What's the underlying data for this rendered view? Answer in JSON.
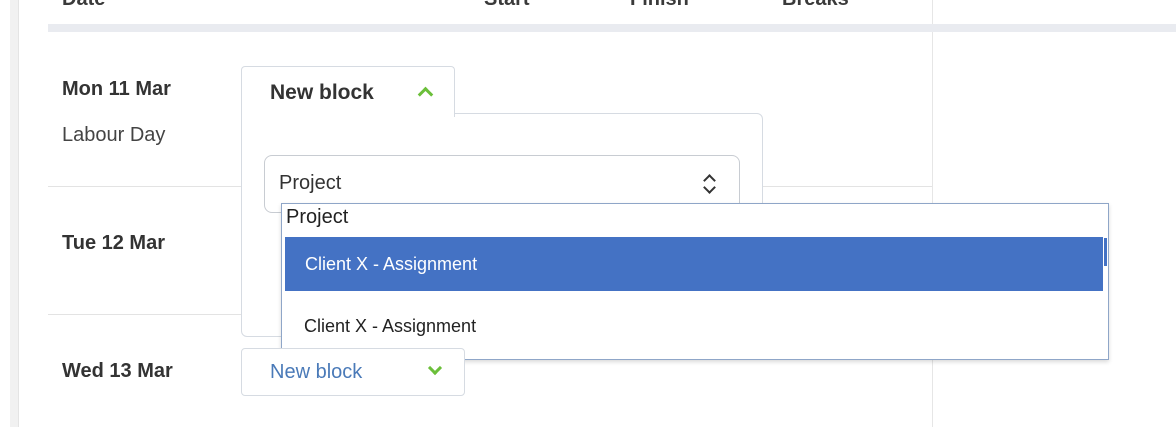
{
  "header": {
    "columns": [
      "Date",
      "Start",
      "Finish",
      "Breaks"
    ]
  },
  "days": [
    {
      "title": "Mon 11 Mar",
      "subtitle": "Labour Day"
    },
    {
      "title": "Tue 12 Mar",
      "subtitle": ""
    },
    {
      "title": "Wed 13 Mar",
      "subtitle": ""
    }
  ],
  "open_block": {
    "tab_label": "New block",
    "chevron_icon": "chevron-up-icon",
    "project_select": {
      "value": "Project",
      "icon": "select-stepper-icon"
    }
  },
  "dropdown": {
    "placeholder": "Project",
    "options": [
      {
        "label": "Client X - Assignment",
        "highlighted": true
      },
      {
        "label": "Client X - Assignment",
        "highlighted": false
      }
    ],
    "highlight_color": "#4472c4"
  },
  "collapsed_block": {
    "label": "New block",
    "chevron_icon": "chevron-down-icon"
  },
  "colors": {
    "accent_green": "#6bbf3a",
    "link_blue": "#4a7ab8"
  }
}
